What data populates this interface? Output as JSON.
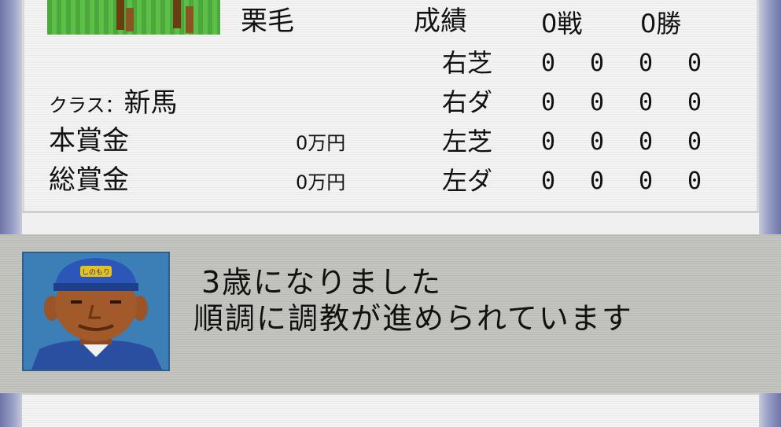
{
  "horse": {
    "coat": "栗毛",
    "class_label": "クラス：",
    "class_value": "新馬"
  },
  "record": {
    "label": "成績",
    "races": "0戦",
    "wins": "0勝",
    "rows": [
      {
        "label": "右芝",
        "values": [
          "0",
          "0",
          "0",
          "0"
        ]
      },
      {
        "label": "右ダ",
        "values": [
          "0",
          "0",
          "0",
          "0"
        ]
      },
      {
        "label": "左芝",
        "values": [
          "0",
          "0",
          "0",
          "0"
        ]
      },
      {
        "label": "左ダ",
        "values": [
          "0",
          "0",
          "0",
          "0"
        ]
      }
    ]
  },
  "prize": {
    "main_label": "本賞金",
    "main_value": "0万円",
    "total_label": "総賞金",
    "total_value": "0万円"
  },
  "dialog": {
    "line1": "3歳になりました",
    "line2": "順調に調教が進められています",
    "speaker_icon": "trainer-portrait",
    "cap_text": "しのもり"
  },
  "colors": {
    "frame": "#8e93b9",
    "panel": "#f4f4f4",
    "dialog": "#c4c5c0",
    "portrait_bg": "#3c7fb7"
  }
}
